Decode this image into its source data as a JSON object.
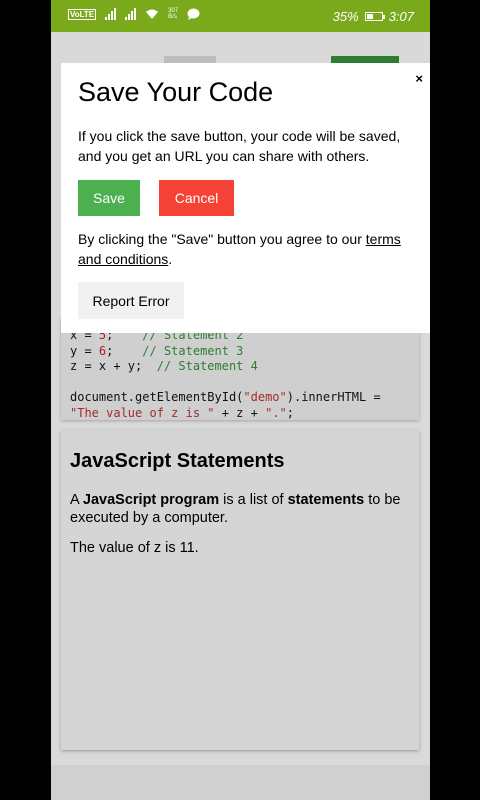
{
  "status_bar": {
    "carrier_tag": "VoLTE",
    "net_speed_top": "307",
    "net_speed_bottom": "B/s",
    "battery": "35%",
    "time": "3:07"
  },
  "code": {
    "line1_a": "x = ",
    "line1_num": "5",
    "line1_b": ";    ",
    "line1_cmt": "// Statement 2",
    "line2_a": "y = ",
    "line2_num": "6",
    "line2_b": ";    ",
    "line2_cmt": "// Statement 3",
    "line3_a": "z = x + y;  ",
    "line3_cmt": "// Statement 4",
    "line5_a": "document.getElementById(",
    "line5_str": "\"demo\"",
    "line5_b": ").innerHTML =",
    "line6_str1": "\"The value of z is \"",
    "line6_a": " + z + ",
    "line6_str2": "\".\"",
    "line6_b": ";"
  },
  "article": {
    "title": "JavaScript Statements",
    "p1_a": "A ",
    "p1_bold1": "JavaScript program",
    "p1_b": " is a list of ",
    "p1_bold2": "statements",
    "p1_c": " to be executed by a computer.",
    "p2": "The value of z is 11."
  },
  "modal": {
    "close": "×",
    "title": "Save Your Code",
    "description": "If you click the save button, your code will be saved, and you get an URL you can share with others.",
    "save_label": "Save",
    "cancel_label": "Cancel",
    "agree_text": "By clicking the \"Save\" button you agree to our ",
    "terms_link": "terms and conditions",
    "agree_end": ".",
    "report_label": "Report Error"
  },
  "colors": {
    "status_bar": "#7aa91c",
    "save": "#4caf50",
    "cancel": "#f44336"
  }
}
